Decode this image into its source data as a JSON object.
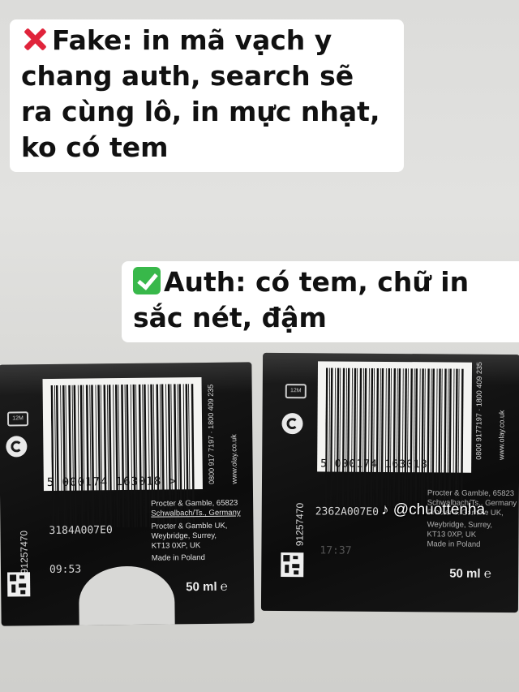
{
  "captions": {
    "fake": "Fake: in mã vạch y chang auth, search sẽ ra cùng lô, in mực nhạt, ko có tem",
    "auth": "Auth: có tem, chữ in sắc nét, đậm"
  },
  "left_box": {
    "barcode_number": "5 000174 163018 >",
    "side_code": "91257470",
    "batch_code": "3184A007E0",
    "time": "09:53",
    "phones": "0800 917 7197 · 1800 409 235",
    "website": "www.olay.co.uk",
    "address": [
      "Procter & Gamble, 65823",
      "Schwalbach/Ts., Germany",
      "Procter & Gamble UK,",
      "Weybridge, Surrey,",
      "KT13 0XP, UK",
      "Made in Poland"
    ],
    "volume": "50 ml ℮",
    "pao": "12M"
  },
  "right_box": {
    "barcode_number": "5 000174 163018",
    "side_code": "91257470",
    "batch_code": "2362A007E0",
    "time": "17:37",
    "phones": "0800 9177197 · 1800 409 235",
    "website": "www.olay.co.uk",
    "address": [
      "Procter & Gamble, 65823",
      "Schwalbach/Ts., Germany",
      "Procter & Gamble UK,",
      "Weybridge, Surrey,",
      "KT13 0XP, UK",
      "Made in Poland"
    ],
    "volume": "50 ml ℮",
    "pao": "12M"
  },
  "watermark": "@chuottenha",
  "colors": {
    "fake_mark": "#e0243b",
    "auth_mark": "#38b84a"
  }
}
